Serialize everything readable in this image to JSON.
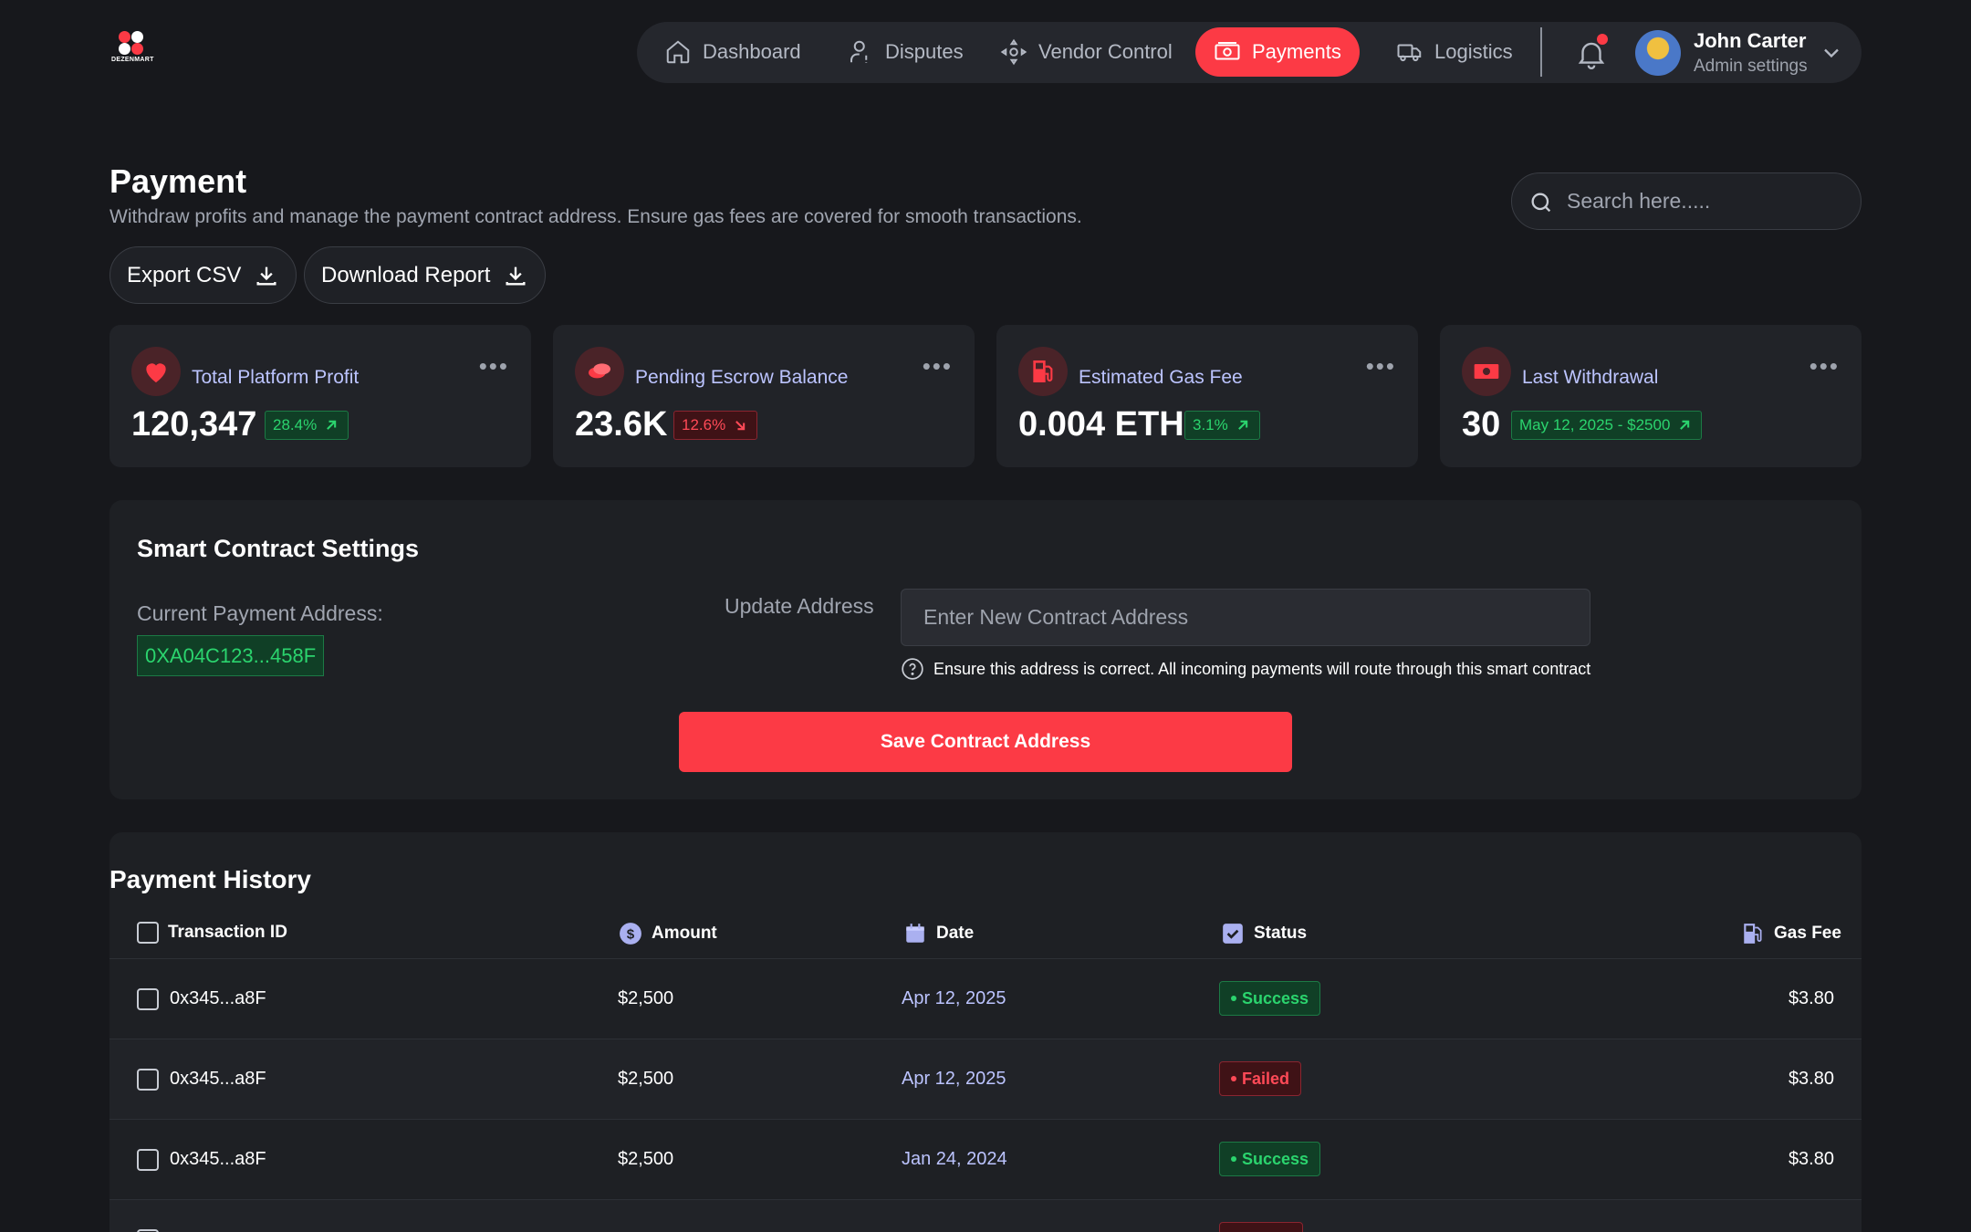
{
  "brand": {
    "name": "DEZENMART"
  },
  "nav": {
    "items": [
      {
        "label": "Dashboard",
        "icon": "home-icon"
      },
      {
        "label": "Disputes",
        "icon": "person-icon"
      },
      {
        "label": "Vendor Control",
        "icon": "move-icon"
      },
      {
        "label": "Payments",
        "icon": "money-icon",
        "active": true
      },
      {
        "label": "Logistics",
        "icon": "truck-icon"
      }
    ],
    "user": {
      "name": "John Carter",
      "role": "Admin settings"
    }
  },
  "header": {
    "title": "Payment",
    "subtitle": "Withdraw profits and manage the payment contract address. Ensure gas fees are covered for smooth transactions.",
    "search_placeholder": "Search here.....",
    "export_label": "Export CSV",
    "download_label": "Download Report"
  },
  "stats": [
    {
      "label": "Total Platform Profit",
      "value": "120,347",
      "badge": "28.4%",
      "trend": "up",
      "icon": "heart-icon"
    },
    {
      "label": "Pending Escrow Balance",
      "value": "23.6K",
      "badge": "12.6%",
      "trend": "down",
      "icon": "coins-icon"
    },
    {
      "label": "Estimated Gas Fee",
      "value": "0.004 ETH",
      "badge": "3.1%",
      "trend": "up",
      "icon": "gas-pump-icon"
    },
    {
      "label": "Last Withdrawal",
      "value": "30",
      "badge": "May 12, 2025 - $2500",
      "trend": "up",
      "icon": "cash-icon"
    }
  ],
  "contract": {
    "title": "Smart Contract Settings",
    "current_label": "Current Payment Address:",
    "current_address": "0XA04C123...458F",
    "update_label": "Update Address",
    "input_placeholder": "Enter New Contract Address",
    "help": "Ensure this address is correct. All incoming payments will route through this smart contract",
    "save_label": "Save Contract Address"
  },
  "history": {
    "title": "Payment History",
    "columns": {
      "id": "Transaction ID",
      "amount": "Amount",
      "date": "Date",
      "status": "Status",
      "gas": "Gas Fee"
    },
    "rows": [
      {
        "id": "0x345...a8F",
        "amount": "$2,500",
        "date": "Apr 12, 2025",
        "status": "Success",
        "gas": "$3.80"
      },
      {
        "id": "0x345...a8F",
        "amount": "$2,500",
        "date": "Apr 12, 2025",
        "status": "Failed",
        "gas": "$3.80"
      },
      {
        "id": "0x345...a8F",
        "amount": "$2,500",
        "date": "Jan 24, 2024",
        "status": "Success",
        "gas": "$3.80"
      }
    ]
  },
  "colors": {
    "accent": "#fc3a45",
    "success": "#2bd46e",
    "danger": "#ff4a57",
    "background": "#17181c"
  }
}
